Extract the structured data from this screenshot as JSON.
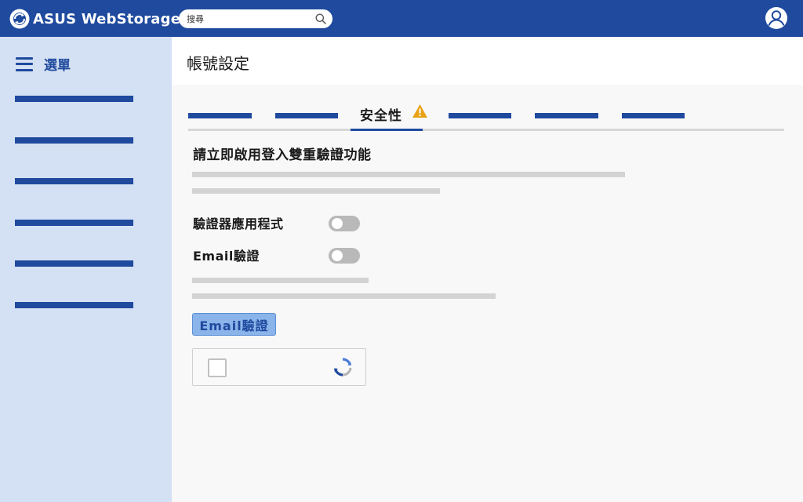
{
  "app": {
    "brand": "ASUS WebStorage"
  },
  "search": {
    "placeholder": "搜尋"
  },
  "sidebar": {
    "menu_label": "選單"
  },
  "page": {
    "title": "帳號設定"
  },
  "tabs": {
    "active_label": "安全性"
  },
  "security": {
    "section_title": "請立即啟用登入雙重驗證功能",
    "rows": [
      {
        "label": "驗證器應用程式",
        "enabled": false
      },
      {
        "label": "Email驗證",
        "enabled": false
      }
    ],
    "email_button": "Email驗證"
  },
  "colors": {
    "primary": "#1f4a9e",
    "sidebar_bg": "#d4e0f3",
    "warning": "#e8a317",
    "button_bg": "#8bb4ea"
  },
  "icons": [
    "asus-logo-icon",
    "search-icon",
    "user-icon",
    "hamburger-icon",
    "warning-icon",
    "recaptcha-icon"
  ]
}
